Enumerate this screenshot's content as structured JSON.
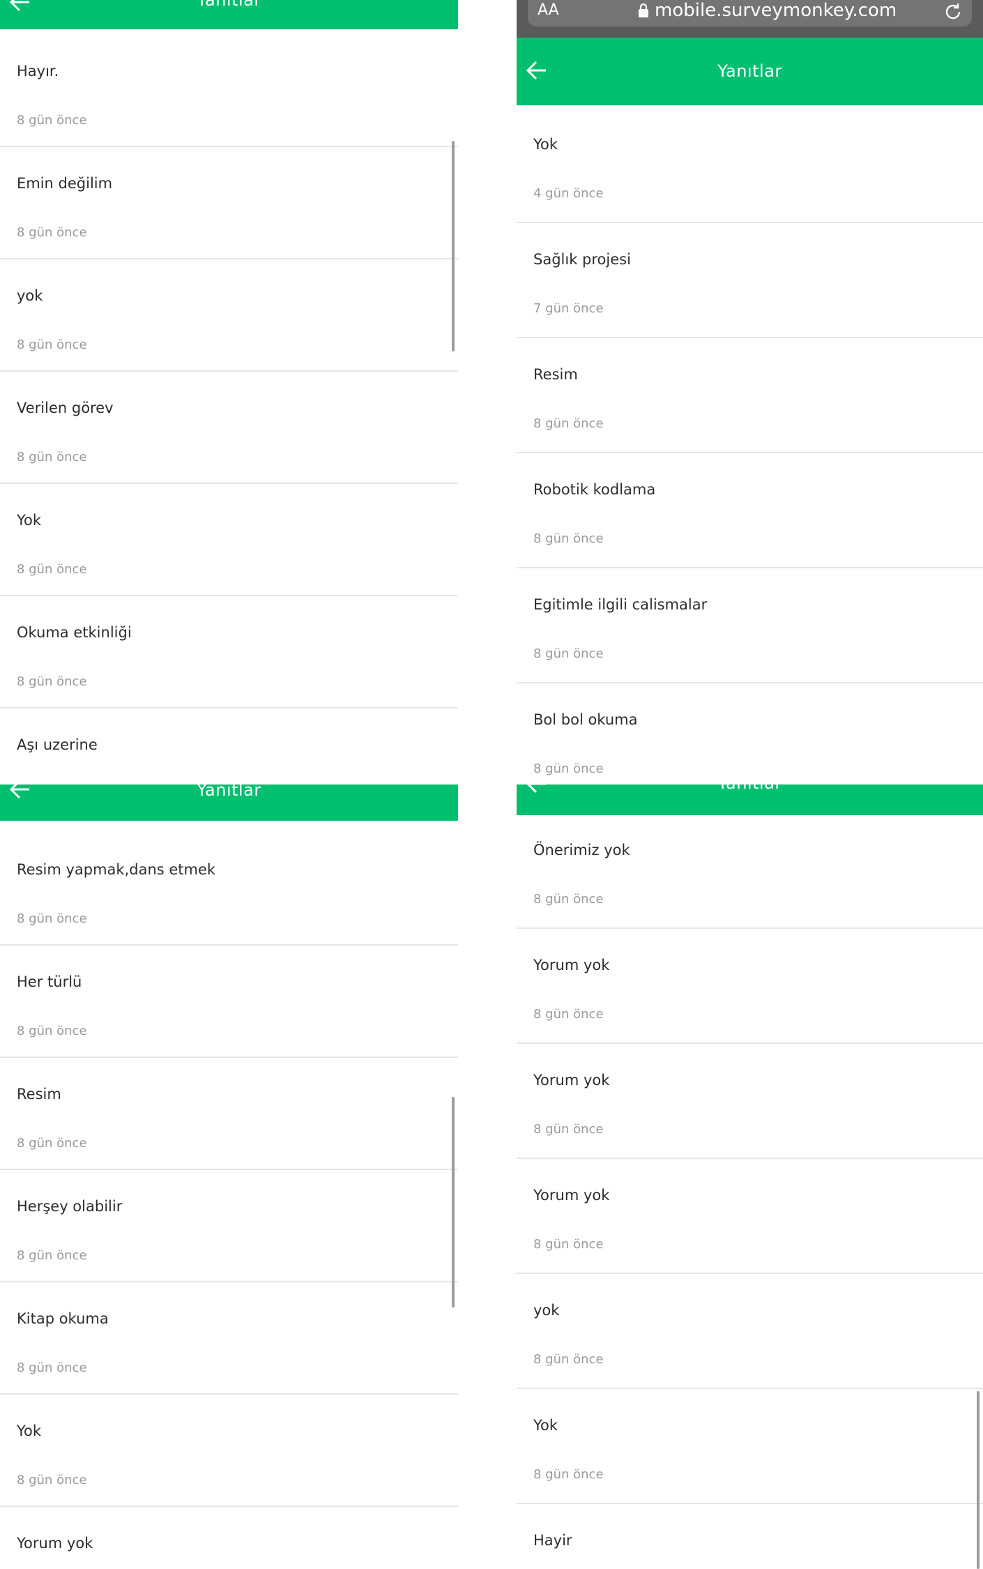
{
  "header_title": "Yanıtlar",
  "browser": {
    "text_size_label": "AA",
    "url": "mobile.surveymonkey.com"
  },
  "colors": {
    "brand_green": "#00bf6f",
    "text": "#2d2d2d",
    "muted": "#9a9a9a"
  },
  "panel_1": {
    "items": [
      {
        "text": "Hayır.",
        "time": "8 gün önce"
      },
      {
        "text": "Emin değilim",
        "time": "8 gün önce"
      },
      {
        "text": "yok",
        "time": "8 gün önce"
      },
      {
        "text": "Verilen görev",
        "time": "8 gün önce"
      },
      {
        "text": "Yok",
        "time": "8 gün önce"
      },
      {
        "text": "Okuma etkinliği",
        "time": "8 gün önce"
      },
      {
        "text": "Aşı uzerine",
        "time": ""
      }
    ]
  },
  "panel_2": {
    "items": [
      {
        "text": "Yok",
        "time": "4 gün önce"
      },
      {
        "text": "Sağlık projesi",
        "time": "7 gün önce"
      },
      {
        "text": "Resim",
        "time": "8 gün önce"
      },
      {
        "text": "Robotik kodlama",
        "time": "8 gün önce"
      },
      {
        "text": "Egitimle ilgili calismalar",
        "time": "8 gün önce"
      },
      {
        "text": "Bol bol okuma",
        "time": "8 gün önce"
      }
    ]
  },
  "panel_3": {
    "items": [
      {
        "text": "Resim yapmak,dans etmek",
        "time": "8 gün önce"
      },
      {
        "text": "Her türlü",
        "time": "8 gün önce"
      },
      {
        "text": "Resim",
        "time": "8 gün önce"
      },
      {
        "text": "Herşey olabilir",
        "time": "8 gün önce"
      },
      {
        "text": "Kitap okuma",
        "time": "8 gün önce"
      },
      {
        "text": "Yok",
        "time": "8 gün önce"
      },
      {
        "text": "Yorum yok",
        "time": ""
      }
    ]
  },
  "panel_4": {
    "items": [
      {
        "text": "Önerimiz yok",
        "time": "8 gün önce"
      },
      {
        "text": "Yorum yok",
        "time": "8 gün önce"
      },
      {
        "text": "Yorum yok",
        "time": "8 gün önce"
      },
      {
        "text": "Yorum yok",
        "time": "8 gün önce"
      },
      {
        "text": "yok",
        "time": "8 gün önce"
      },
      {
        "text": "Yok",
        "time": "8 gün önce"
      },
      {
        "text": "Hayir",
        "time": ""
      }
    ]
  }
}
